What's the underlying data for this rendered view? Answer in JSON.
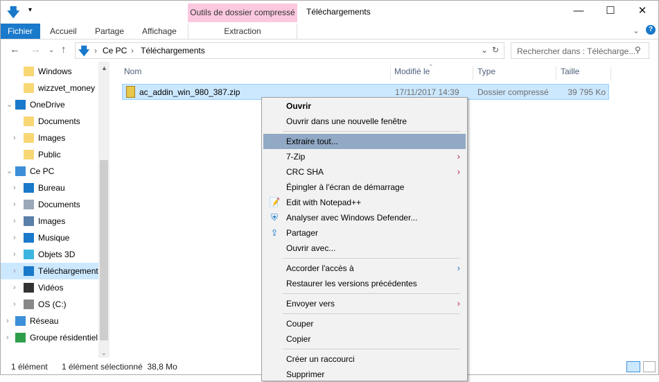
{
  "window": {
    "title": "Téléchargements",
    "context_tab": "Outils de dossier compressé",
    "minimize": "—",
    "maximize": "☐",
    "close": "✕"
  },
  "ribbon": {
    "tabs": [
      "Fichier",
      "Accueil",
      "Partage",
      "Affichage",
      "Extraction"
    ]
  },
  "address": {
    "path": [
      "Ce PC",
      "Téléchargements"
    ],
    "search_placeholder": "Rechercher dans : Télécharge..."
  },
  "sidebar": {
    "items": [
      {
        "label": "Windows",
        "icon": "folder-icon",
        "indent": 1
      },
      {
        "label": "wizzvet_money",
        "icon": "folder-icon",
        "indent": 1
      },
      {
        "label": "OneDrive",
        "icon": "cloud-icon",
        "indent": 0,
        "expanded": true
      },
      {
        "label": "Documents",
        "icon": "folder-icon",
        "indent": 1
      },
      {
        "label": "Images",
        "icon": "folder-icon",
        "indent": 1,
        "chev": true
      },
      {
        "label": "Public",
        "icon": "folder-icon",
        "indent": 1
      },
      {
        "label": "Ce PC",
        "icon": "computer-icon",
        "indent": 0,
        "expanded": true
      },
      {
        "label": "Bureau",
        "icon": "desktop-icon",
        "indent": 1,
        "chev": true
      },
      {
        "label": "Documents",
        "icon": "documents-icon",
        "indent": 1,
        "chev": true
      },
      {
        "label": "Images",
        "icon": "pictures-icon",
        "indent": 1,
        "chev": true
      },
      {
        "label": "Musique",
        "icon": "music-icon",
        "indent": 1,
        "chev": true
      },
      {
        "label": "Objets 3D",
        "icon": "cube-icon",
        "indent": 1,
        "chev": true
      },
      {
        "label": "Téléchargements",
        "icon": "download-icon",
        "indent": 1,
        "chev": true,
        "selected": true
      },
      {
        "label": "Vidéos",
        "icon": "video-icon",
        "indent": 1,
        "chev": true
      },
      {
        "label": "OS (C:)",
        "icon": "drive-icon",
        "indent": 1,
        "chev": true
      },
      {
        "label": "Réseau",
        "icon": "network-icon",
        "indent": 0,
        "chev": true
      },
      {
        "label": "Groupe résidentiel",
        "icon": "homegroup-icon",
        "indent": 0,
        "chev": true
      }
    ]
  },
  "columns": [
    "Nom",
    "Modifié le",
    "Type",
    "Taille"
  ],
  "files": [
    {
      "name": "ac_addin_win_980_387.zip",
      "modified": "17/11/2017 14:39",
      "type": "Dossier compressé",
      "size": "39 795 Ko"
    }
  ],
  "status": {
    "count": "1 élément",
    "selected": "1 élément sélectionné  38,8 Mo"
  },
  "context_menu": [
    {
      "label": "Ouvrir",
      "bold": true
    },
    {
      "label": "Ouvrir dans une nouvelle fenêtre"
    },
    {
      "sep": true
    },
    {
      "label": "Extraire tout...",
      "highlighted": true
    },
    {
      "label": "7-Zip",
      "submenu": true
    },
    {
      "label": "CRC SHA",
      "submenu": true
    },
    {
      "label": "Épingler à l'écran de démarrage"
    },
    {
      "label": "Edit with Notepad++",
      "icon": "notepad-icon"
    },
    {
      "label": "Analyser avec Windows Defender...",
      "icon": "shield-icon"
    },
    {
      "label": "Partager",
      "icon": "share-icon"
    },
    {
      "label": "Ouvrir avec..."
    },
    {
      "sep": true
    },
    {
      "label": "Accorder l'accès à",
      "submenu": true,
      "blue": true
    },
    {
      "label": "Restaurer les versions précédentes"
    },
    {
      "sep": true
    },
    {
      "label": "Envoyer vers",
      "submenu": true
    },
    {
      "sep": true
    },
    {
      "label": "Couper"
    },
    {
      "label": "Copier"
    },
    {
      "sep": true
    },
    {
      "label": "Créer un raccourci"
    },
    {
      "label": "Supprimer"
    }
  ],
  "colors": {
    "accent": "#1979ca",
    "context_tab": "#fbc8e0",
    "selection": "#cce8ff",
    "menu_highlight": "#91a9c4"
  }
}
